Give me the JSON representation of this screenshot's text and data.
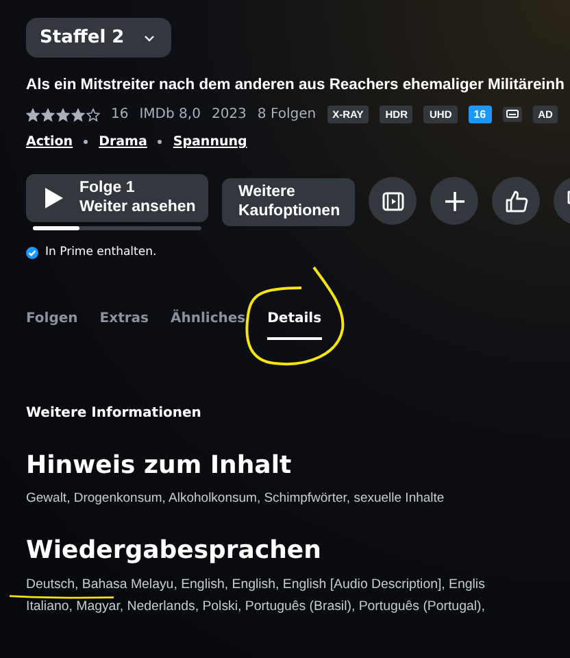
{
  "season_selector": {
    "label": "Staffel 2"
  },
  "description": "Als ein Mitstreiter nach dem anderen aus Reachers ehemaliger Militäreinh",
  "meta": {
    "stars": 4,
    "rating_count": "16",
    "imdb": "IMDb 8,0",
    "year": "2023",
    "episodes": "8 Folgen",
    "badges": [
      {
        "kind": "text",
        "label": "X-RAY"
      },
      {
        "kind": "text",
        "label": "HDR"
      },
      {
        "kind": "text",
        "label": "UHD"
      },
      {
        "kind": "age",
        "label": "16"
      },
      {
        "kind": "subtitles"
      },
      {
        "kind": "text",
        "label": "AD"
      }
    ]
  },
  "genres": [
    "Action",
    "Drama",
    "Spannung"
  ],
  "play_button": {
    "line1": "Folge 1",
    "line2": "Weiter ansehen",
    "level": 0.28
  },
  "buy_button": {
    "label": "Weitere Kaufoptionen"
  },
  "prime_note": {
    "label": "In Prime enthalten.",
    "checked": true
  },
  "tabs": [
    {
      "label": "Folgen",
      "selected": false
    },
    {
      "label": "Extras",
      "selected": false
    },
    {
      "label": "Ähnliches",
      "selected": false
    },
    {
      "label": "Details",
      "selected": true
    }
  ],
  "section_title": "Weitere Informationen",
  "content_note": {
    "heading": "Hinweis zum Inhalt",
    "text": "Gewalt, Drogenkonsum, Alkoholkonsum, Schimpfwörter, sexuelle Inhalte"
  },
  "languages": {
    "heading": "Wiedergabesprachen",
    "lines": [
      "Deutsch, Bahasa Melayu, English, English, English [Audio Description], Englis",
      "Italiano, Magyar, Nederlands, Polski, Português (Brasil), Português (Portugal),"
    ]
  }
}
